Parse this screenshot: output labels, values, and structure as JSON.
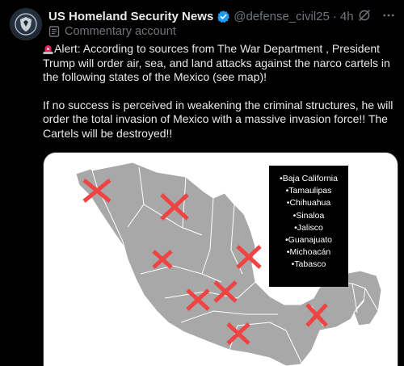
{
  "author": {
    "display_name": "US Homeland Security News",
    "handle": "@defense_civil25",
    "separator": "·",
    "time": "4h",
    "account_type": "Commentary account",
    "verified_icon": "verified-badge-icon",
    "avatar_icon": "shield-emblem-icon"
  },
  "post": {
    "paragraph_1": "Alert: According to sources from The War Department , President Trump will order air, sea, and land attacks against the narco cartels in the following states of the Mexico (see map)!",
    "paragraph_2": "If no success is perceived in weakening the criminal structures, he will order the total invasion of Mexico with a massive invasion force!! The Cartels will be destroyed!!",
    "alert_icon": "police-light-icon"
  },
  "map": {
    "legend": [
      "•Baja California",
      "•Tamaulipas",
      "•Chihuahua",
      "•Sinaloa",
      "•Jalisco",
      "•Guanajuato",
      "•Michoacán",
      "•Tabasco"
    ],
    "marker_count": 8
  },
  "colors": {
    "background": "#000000",
    "text": "#e7e9ea",
    "muted": "#71767b",
    "verified": "#1d9bf0",
    "marker": "#ee4444",
    "land": "#a8a8a8"
  }
}
